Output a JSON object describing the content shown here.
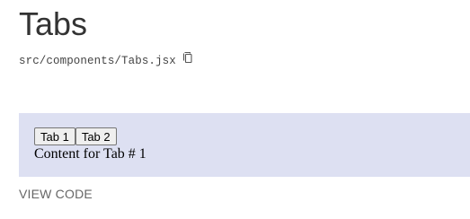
{
  "header": {
    "title": "Tabs",
    "file_path": "src/components/Tabs.jsx",
    "copy_icon": "copy-icon"
  },
  "preview": {
    "background_color": "#dde0f2",
    "tabs": [
      {
        "label": "Tab 1"
      },
      {
        "label": "Tab 2"
      }
    ],
    "content": "Content for Tab # 1"
  },
  "footer": {
    "view_code_label": "VIEW CODE"
  }
}
